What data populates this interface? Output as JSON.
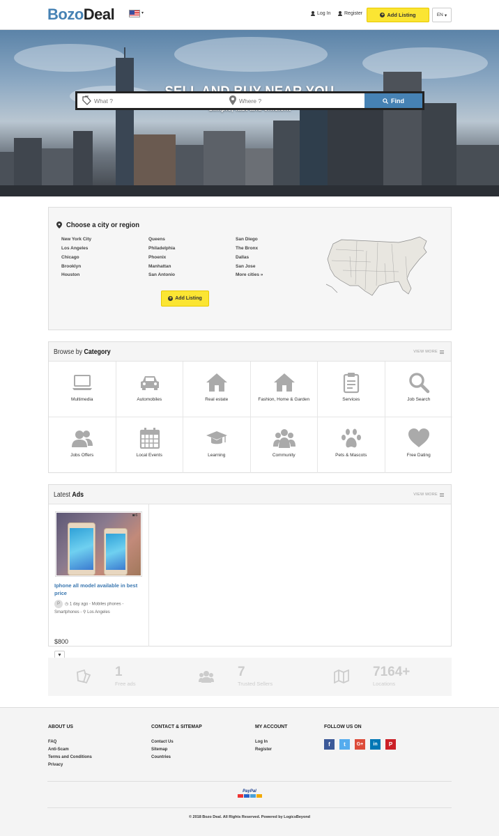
{
  "header": {
    "logo_part1": "Bozo",
    "logo_part2": "Deal",
    "language_flag": "us-flag-icon",
    "login_label": "Log In",
    "register_label": "Register",
    "add_listing_label": "Add Listing",
    "language": "EN"
  },
  "hero": {
    "title": "SELL AND BUY NEAR YOU",
    "subtitle": "Simple, fast and efficient",
    "what_placeholder": "What ?",
    "where_placeholder": "Where ?",
    "find_label": "Find"
  },
  "cities": {
    "title": "Choose a city or region",
    "columns": [
      [
        "New York City",
        "Los Angeles",
        "Chicago",
        "Brooklyn",
        "Houston"
      ],
      [
        "Queens",
        "Philadelphia",
        "Phoenix",
        "Manhattan",
        "San Antonio"
      ],
      [
        "San Diego",
        "The Bronx",
        "Dallas",
        "San Jose",
        "More cities »"
      ]
    ],
    "add_listing_label": "Add Listing"
  },
  "categories": {
    "title_light": "Browse by",
    "title_bold": "Category",
    "view_more": "VIEW MORE",
    "items": [
      {
        "label": "Multimedia",
        "icon": "laptop-icon"
      },
      {
        "label": "Automobiles",
        "icon": "car-icon"
      },
      {
        "label": "Real estate",
        "icon": "house-icon"
      },
      {
        "label": "Fashion, Home & Garden",
        "icon": "home-icon"
      },
      {
        "label": "Services",
        "icon": "clipboard-icon"
      },
      {
        "label": "Job Search",
        "icon": "search-icon"
      },
      {
        "label": "Jobs Offers",
        "icon": "users-icon"
      },
      {
        "label": "Local Events",
        "icon": "calendar-icon"
      },
      {
        "label": "Learning",
        "icon": "graduation-cap-icon"
      },
      {
        "label": "Community",
        "icon": "group-icon"
      },
      {
        "label": "Pets & Mascots",
        "icon": "paw-icon"
      },
      {
        "label": "Free Dating",
        "icon": "heart-icon"
      }
    ]
  },
  "latest_ads": {
    "title_light": "Latest",
    "title_bold": "Ads",
    "view_more": "VIEW MORE",
    "ads": [
      {
        "photo_count": "6",
        "title": "Iphone all model available in best price",
        "avatar_letter": "P",
        "time": "1 day ago",
        "category": "Mobiles phones - Smartphones",
        "location": "Los Angeles",
        "price": "$800"
      }
    ]
  },
  "stats": [
    {
      "number": "1",
      "caption": "Free ads",
      "icon": "ads-icon"
    },
    {
      "number": "7",
      "caption": "Trusted Sellers",
      "icon": "users-icon"
    },
    {
      "number": "7164+",
      "caption": "Locations",
      "icon": "map-icon"
    }
  ],
  "footer": {
    "about": {
      "heading": "ABOUT US",
      "links": [
        "FAQ",
        "Anti-Scam",
        "Terms and Conditions",
        "Privacy"
      ]
    },
    "contact": {
      "heading": "CONTACT & SITEMAP",
      "links": [
        "Contact Us",
        "Sitemap",
        "Countries"
      ]
    },
    "account": {
      "heading": "MY ACCOUNT",
      "links": [
        "Log In",
        "Register"
      ]
    },
    "follow": {
      "heading": "FOLLOW US ON",
      "networks": [
        {
          "glyph": "f",
          "icon": "facebook-icon",
          "color": "#3b5998"
        },
        {
          "glyph": "t",
          "icon": "twitter-icon",
          "color": "#55acee"
        },
        {
          "glyph": "G+",
          "icon": "google-plus-icon",
          "color": "#dd4b39"
        },
        {
          "glyph": "in",
          "icon": "linkedin-icon",
          "color": "#0077b5"
        },
        {
          "glyph": "P",
          "icon": "pinterest-icon",
          "color": "#cb2027"
        }
      ]
    },
    "payment_label": "PayPal",
    "copyright": "© 2018 Bozo Deal. All Rights Reserved. Powered by LogicsBeyond"
  },
  "colors": {
    "accent": "#4682b4",
    "button_yellow": "#fbe533"
  }
}
